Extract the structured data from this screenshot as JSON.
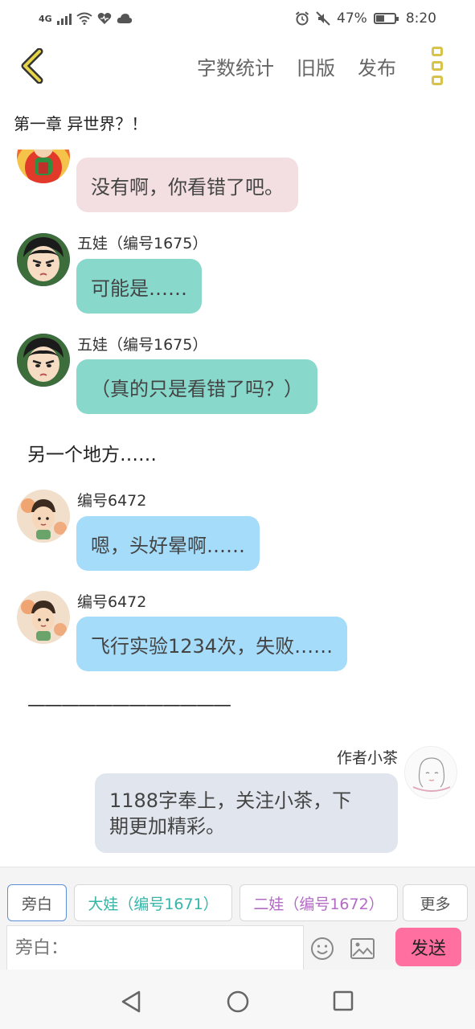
{
  "status_bar": {
    "network": "4G",
    "battery_percent": "47%",
    "battery_level": 0.47,
    "time": "8:20"
  },
  "header": {
    "word_count": "字数统计",
    "old_version": "旧版",
    "publish": "发布",
    "back_icon": "chevron-left-icon",
    "more_icon": "vertical-dots-icon"
  },
  "chapter": {
    "title": "第一章 异世界？！"
  },
  "messages": [
    {
      "speaker": "",
      "text": "没有啊，你看错了吧。",
      "bubble_color": "#f3dfe1"
    },
    {
      "speaker": "五娃（编号1675）",
      "text": "可能是……",
      "bubble_color": "#88d8cc"
    },
    {
      "speaker": "五娃（编号1675）",
      "text": "（真的只是看错了吗？）",
      "bubble_color": "#88d8cc"
    },
    {
      "narration": "另一个地方……"
    },
    {
      "speaker": "编号6472",
      "text": "嗯，头好晕啊……",
      "bubble_color": "#a5dcfa"
    },
    {
      "speaker": "编号6472",
      "text": "飞行实验1234次，失败……",
      "bubble_color": "#a5dcfa"
    },
    {
      "narration": "————————————"
    },
    {
      "speaker": "作者小茶",
      "text_line1": "1188字奉上，关注小茶，下",
      "text_line2": "期更加精彩。",
      "bubble_color": "#e1e6ee"
    }
  ],
  "roles": {
    "narrator": "旁白",
    "dawa": "大娃（编号1671）",
    "erwa": "二娃（编号1672）",
    "more": "更多",
    "dawa_color": "#36b5a8",
    "erwa_color": "#b36bc4"
  },
  "composer": {
    "placeholder": "旁白：",
    "send": "发送",
    "send_color": "#ff6fa0"
  },
  "nav": {
    "back_icon": "triangle-back-icon",
    "home_icon": "circle-home-icon",
    "recent_icon": "square-recent-icon"
  }
}
